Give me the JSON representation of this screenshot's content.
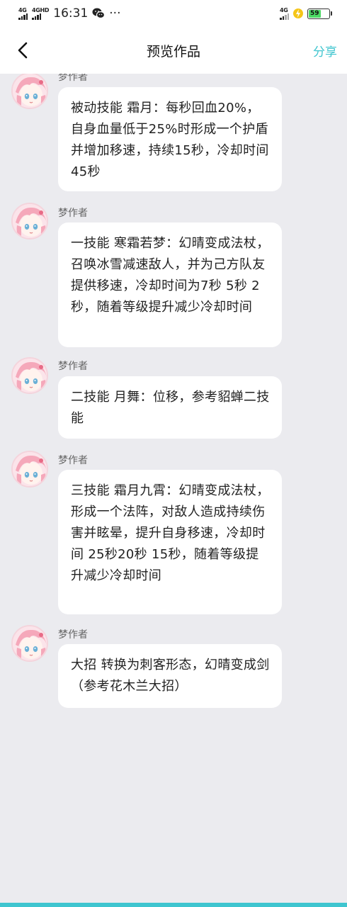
{
  "status_bar": {
    "net1": "4G",
    "net2": "4GHD",
    "time": "16:31",
    "dots": "···",
    "net_right": "4G",
    "battery": "59"
  },
  "nav": {
    "title": "预览作品",
    "share_label": "分享"
  },
  "messages": [
    {
      "author": "梦作者",
      "text": "被动技能 霜月：每秒回血20%，自身血量低于25%时形成一个护盾并增加移速，持续15秒，冷却时间45秒"
    },
    {
      "author": "梦作者",
      "text": "一技能 寒霜若梦：幻晴变成法杖，召唤冰雪减速敌人，并为己方队友提供移速，冷却时间为7秒 5秒 2秒，随着等级提升减少冷却时间"
    },
    {
      "author": "梦作者",
      "text": "二技能 月舞：位移，参考貂蝉二技能"
    },
    {
      "author": "梦作者",
      "text": "三技能 霜月九霄：幻晴变成法杖，形成一个法阵，对敌人造成持续伤害并眩晕，提升自身移速，冷却时间 25秒20秒 15秒，随着等级提升减少冷却时间"
    },
    {
      "author": "梦作者",
      "text": "大招 转换为刺客形态，幻晴变成剑（参考花木兰大招）"
    }
  ],
  "colors": {
    "accent": "#3fc5cf",
    "background": "#ebebef",
    "bubble": "#ffffff"
  }
}
